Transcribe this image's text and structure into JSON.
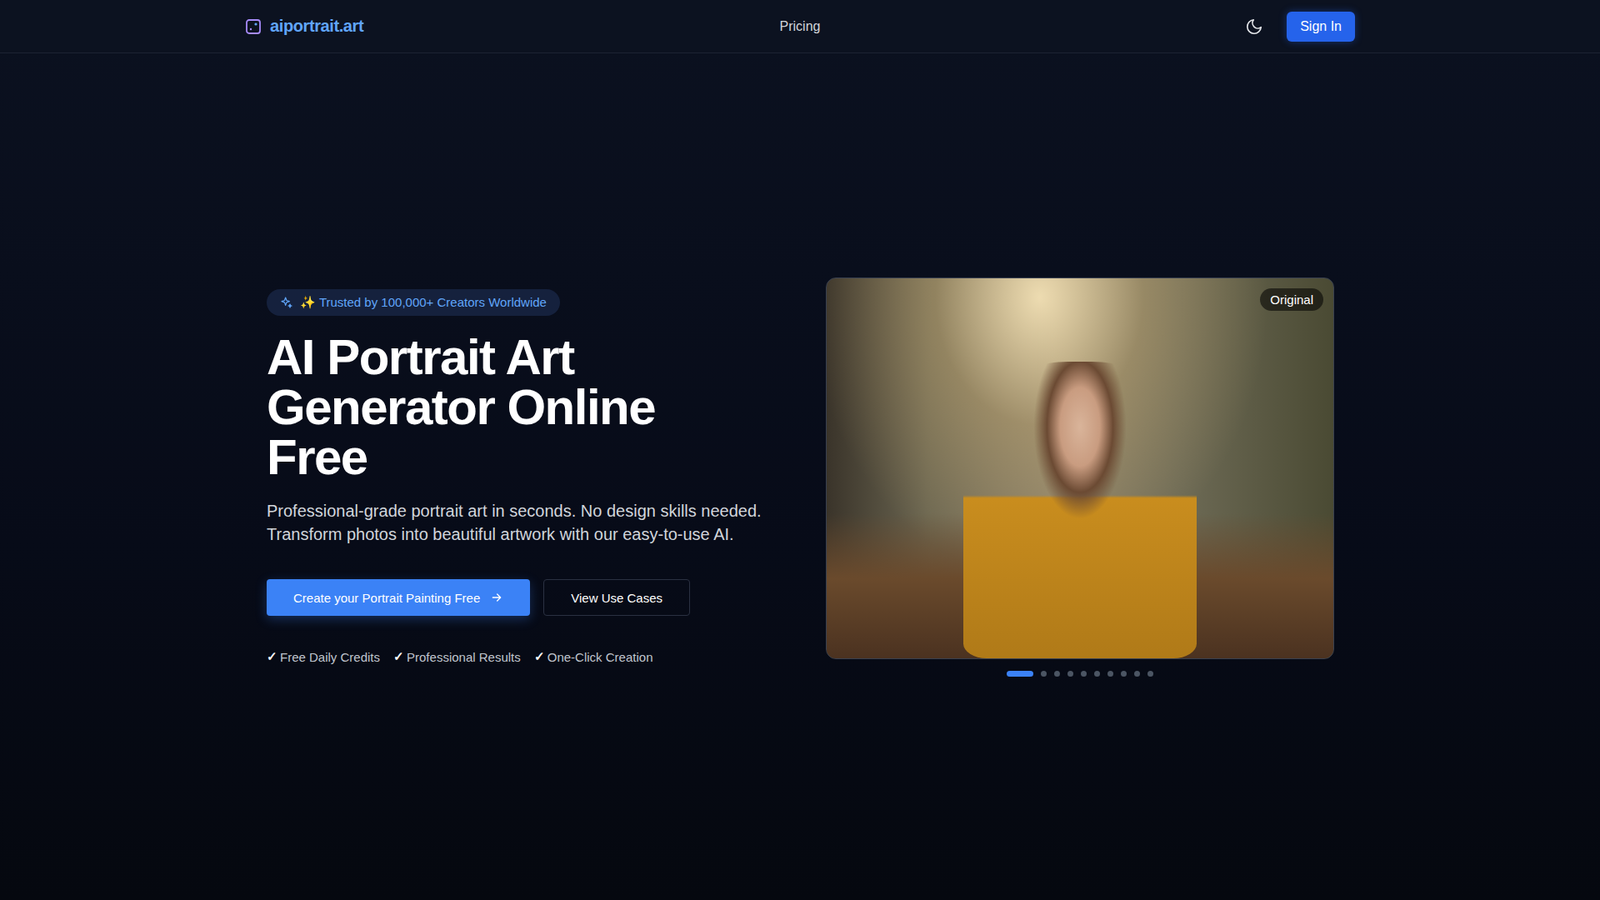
{
  "header": {
    "logo": "aiportrait.art",
    "nav": [
      "Pricing"
    ],
    "sign_in": "Sign In"
  },
  "hero": {
    "badge": "✨ Trusted by 100,000+ Creators Worldwide",
    "title": "AI Portrait Art Generator Online Free",
    "subtitle": "Professional-grade portrait art in seconds. No design skills needed. Transform photos into beautiful artwork with our easy-to-use AI.",
    "primary_button": "Create your Portrait Painting Free",
    "secondary_button": "View Use Cases",
    "features": [
      {
        "check": "✓",
        "label": "Free Daily Credits"
      },
      {
        "check": "✓",
        "label": "Professional Results"
      },
      {
        "check": "✓",
        "label": "One-Click Creation"
      }
    ]
  },
  "showcase": {
    "label": "Original",
    "dots": [
      {
        "selected": true
      },
      {
        "selected": false
      },
      {
        "selected": false
      },
      {
        "selected": false
      },
      {
        "selected": false
      },
      {
        "selected": false
      },
      {
        "selected": false
      },
      {
        "selected": false
      },
      {
        "selected": false
      },
      {
        "selected": false
      }
    ]
  }
}
